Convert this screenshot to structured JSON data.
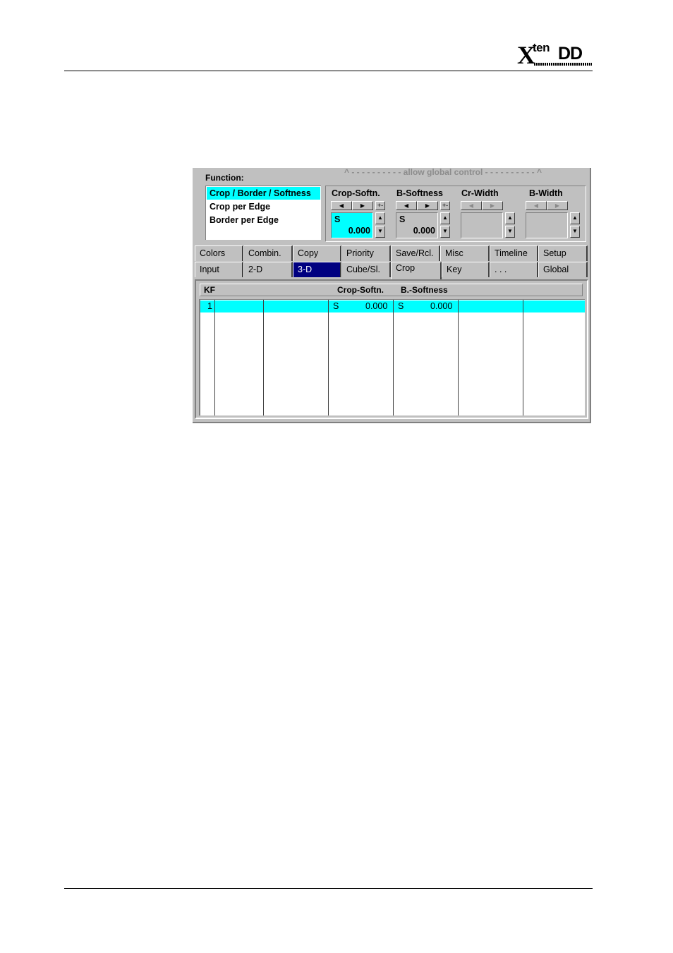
{
  "header": {
    "logo_x": "X",
    "logo_ten": "ten",
    "logo_dd": "DD"
  },
  "panel": {
    "global_control": "^ - - - - - - - - - - allow global control - - - - - - - - - - ^",
    "function_label": "Function:",
    "functions": [
      "Crop / Border / Softness",
      "Crop per Edge",
      "Border per Edge"
    ],
    "selected_function": "Crop / Border / Softness",
    "controls": [
      {
        "label": "Crop-Softn.",
        "mode": "S",
        "value": "0.000",
        "active": true
      },
      {
        "label": "B-Softness",
        "mode": "S",
        "value": "0.000",
        "active": true
      },
      {
        "label": "Cr-Width",
        "mode": "",
        "value": "",
        "active": false
      },
      {
        "label": "B-Width",
        "mode": "",
        "value": "",
        "active": false
      }
    ],
    "pm_symbol": "+-",
    "arrow_left": "◀",
    "arrow_right": "▶",
    "spin_up": "▲",
    "spin_down": "▼",
    "tabs_top": [
      "Colors",
      "Combin.",
      "Copy",
      "Priority",
      "Save/Rcl.",
      "Misc",
      "Timeline",
      "Setup"
    ],
    "tabs_bottom": [
      "Input",
      "2-D",
      "3-D",
      "Cube/Sl.",
      "Crop",
      "Key",
      ". . .",
      "Global"
    ],
    "active_tab": "Crop",
    "highlight_tab": "3-D",
    "table": {
      "headers": {
        "kf": "KF",
        "crop_softn": "Crop-Softn.",
        "b_softness": "B.-Softness"
      },
      "rows": [
        {
          "kf": "1",
          "crop_mode": "S",
          "crop_value": "0.000",
          "b_mode": "S",
          "b_value": "0.000"
        }
      ]
    }
  }
}
